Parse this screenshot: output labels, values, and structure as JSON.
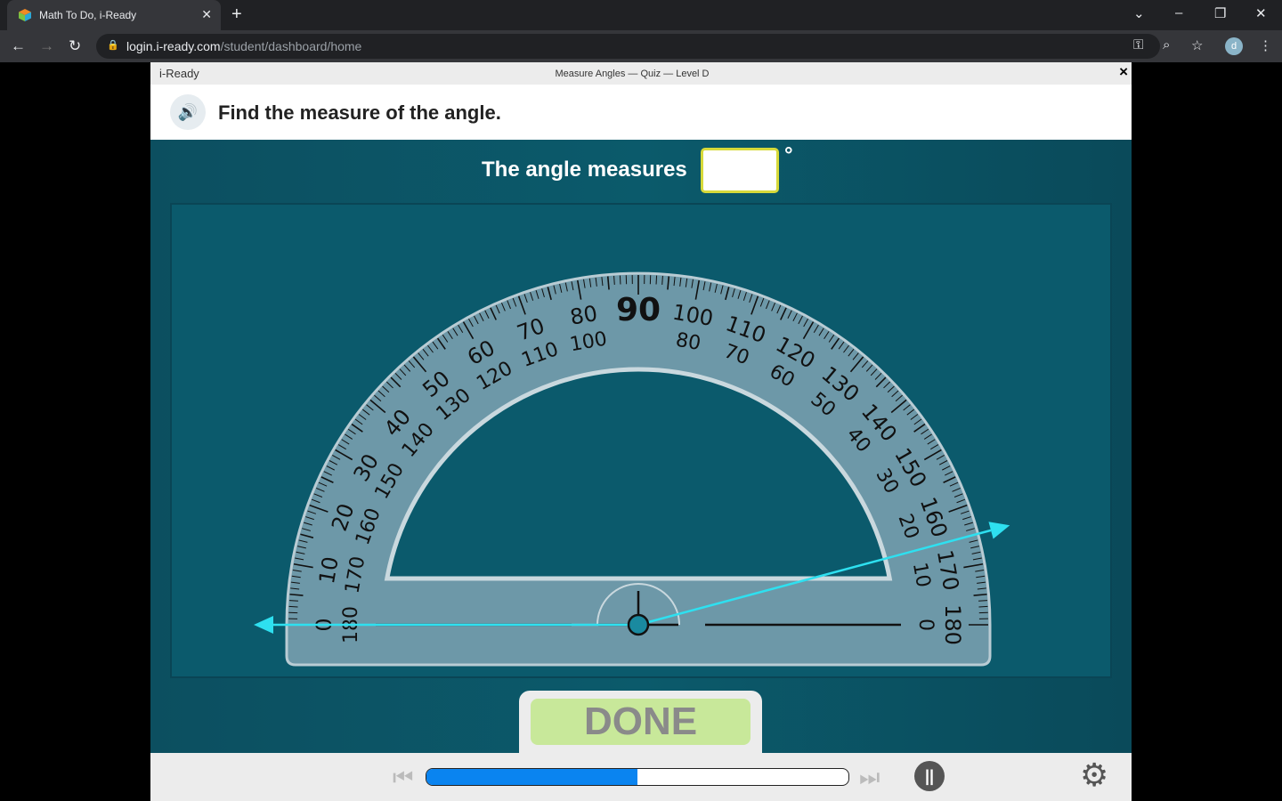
{
  "browser": {
    "tab_title": "Math To Do, i-Ready",
    "url_host": "login.i-ready.com",
    "url_path": "/student/dashboard/home",
    "avatar_letter": "d"
  },
  "app": {
    "logo": "i-Ready",
    "title": "Measure Angles — Quiz — Level D",
    "close": "×"
  },
  "question": {
    "text": "Find the measure of the angle.",
    "prompt": "The angle measures",
    "answer_value": "",
    "degree_symbol": "°"
  },
  "protractor": {
    "outer_labels": [
      "0",
      "10",
      "20",
      "30",
      "40",
      "50",
      "60",
      "70",
      "80",
      "90",
      "100",
      "110",
      "120",
      "130",
      "140",
      "150",
      "160",
      "170",
      "180"
    ],
    "inner_labels": [
      "180",
      "170",
      "160",
      "150",
      "140",
      "130",
      "120",
      "110",
      "100",
      "",
      "80",
      "70",
      "60",
      "50",
      "40",
      "30",
      "20",
      "10",
      "0"
    ],
    "ray_angle_deg": 15,
    "ray_color": "#2ee0f0"
  },
  "done_label": "DONE",
  "progress_fraction": 0.5,
  "colors": {
    "stage": "#0b5a6b",
    "progress": "#0a84f0",
    "done_bg": "#c8e89a"
  }
}
